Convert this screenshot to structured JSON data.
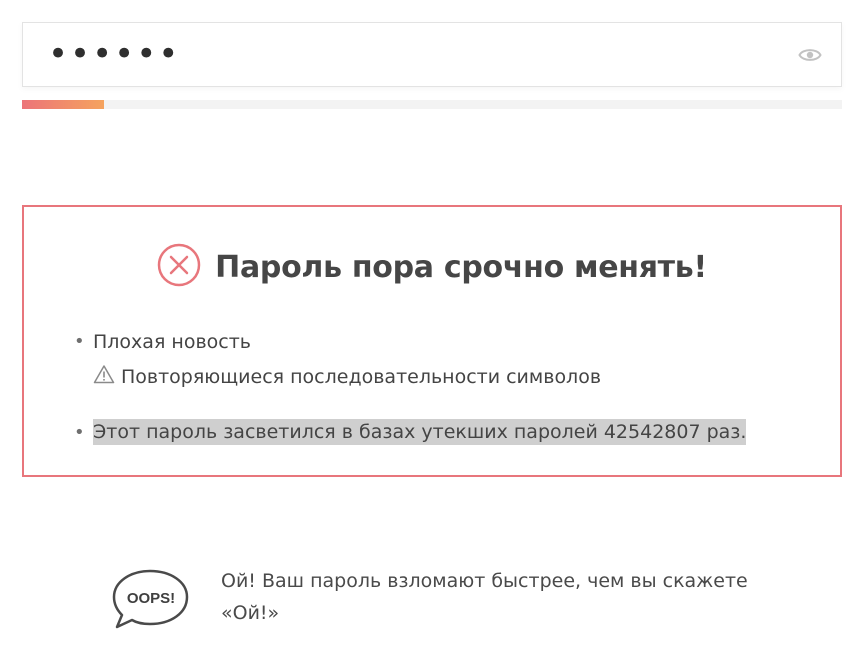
{
  "password_field": {
    "masked_value": "••••••",
    "visibility_icon": "eye-icon"
  },
  "strength_meter": {
    "fill_fraction": 0.1,
    "colors": [
      "#ec7479",
      "#f5a35e"
    ]
  },
  "alert": {
    "icon": "error-circle-x-icon",
    "title": "Пароль пора срочно менять!",
    "border_color": "#e8767c",
    "items": [
      {
        "label": "Плохая новость",
        "sub_icon": "warning-triangle-icon",
        "sub_label": "Повторяющиеся последовательности символов"
      },
      {
        "label": "Этот пароль засветился в базах утекших паролей 42542807 раз."
      }
    ]
  },
  "tip": {
    "bubble_icon": "speech-bubble-icon",
    "bubble_text": "OOPS!",
    "line1": "Ой! Ваш пароль взломают быстрее, чем вы скажете",
    "line2": "«Ой!»"
  }
}
